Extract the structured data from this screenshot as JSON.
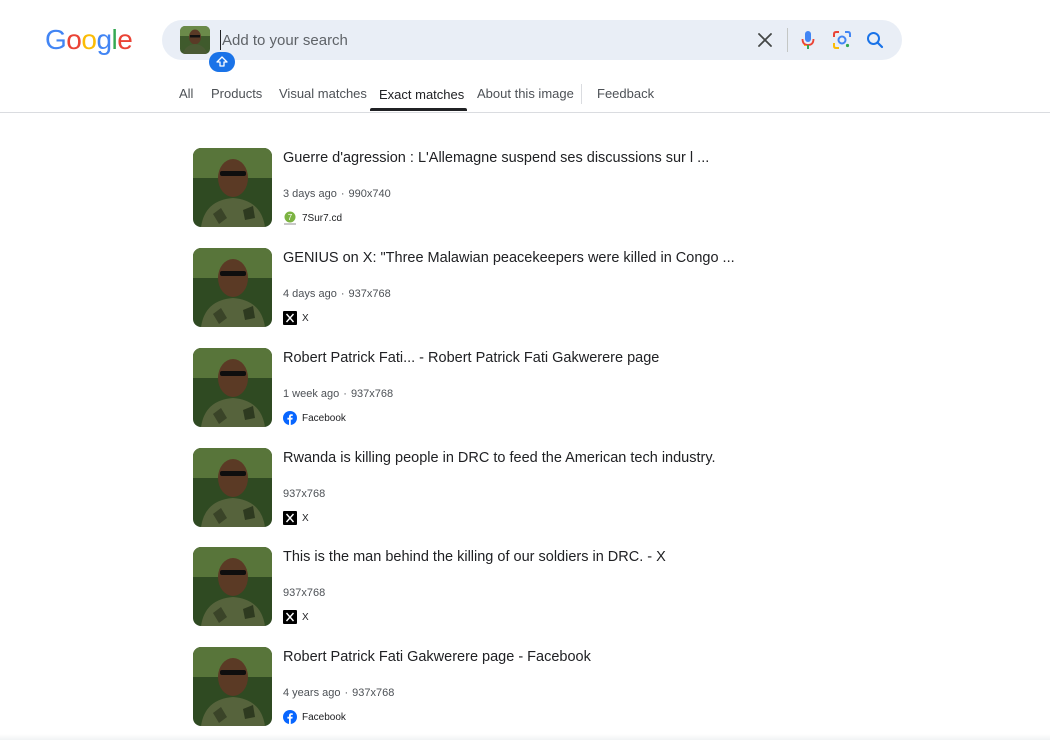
{
  "logo": {
    "text": "Google",
    "letters": [
      "G",
      "o",
      "o",
      "g",
      "l",
      "e"
    ],
    "colors": [
      "#4285F4",
      "#EA4335",
      "#FBBC05",
      "#4285F4",
      "#34A853",
      "#EA4335"
    ]
  },
  "search": {
    "placeholder": "Add to your search",
    "value": ""
  },
  "icons": {
    "clear": "close-icon",
    "voice": "microphone-icon",
    "lens": "lens-camera-icon",
    "search": "search-icon",
    "upload": "upload-arrow-icon"
  },
  "tabs": [
    {
      "label": "All",
      "active": false
    },
    {
      "label": "Products",
      "active": false
    },
    {
      "label": "Visual matches",
      "active": false
    },
    {
      "label": "Exact matches",
      "active": true
    },
    {
      "label": "About this image",
      "active": false
    },
    {
      "label": "Feedback",
      "active": false
    }
  ],
  "results": [
    {
      "title": "Guerre d'agression : L'Allemagne suspend ses discussions sur l ...",
      "age": "3 days ago",
      "dims": "990x740",
      "source": "7Sur7.cd",
      "source_icon": "7sur7-icon"
    },
    {
      "title": "GENIUS on X: \"Three Malawian peacekeepers were killed in Congo ...",
      "age": "4 days ago",
      "dims": "937x768",
      "source": "X",
      "source_icon": "x-logo-icon"
    },
    {
      "title": "Robert Patrick Fati... - Robert Patrick Fati Gakwerere page",
      "age": "1 week ago",
      "dims": "937x768",
      "source": "Facebook",
      "source_icon": "facebook-icon"
    },
    {
      "title": "Rwanda is killing people in DRC to feed the American tech industry.",
      "age": "",
      "dims": "937x768",
      "source": "X",
      "source_icon": "x-logo-icon"
    },
    {
      "title": "This is the man behind the killing of our soldiers in DRC. - X",
      "age": "",
      "dims": "937x768",
      "source": "X",
      "source_icon": "x-logo-icon"
    },
    {
      "title": "Robert Patrick Fati Gakwerere page - Facebook",
      "age": "4 years ago",
      "dims": "937x768",
      "source": "Facebook",
      "source_icon": "facebook-icon"
    }
  ],
  "colors": {
    "accent": "#1a73e8",
    "text": "#202124",
    "muted": "#4d5156",
    "searchbar_bg": "#e9eef6",
    "facebook": "#0866ff"
  }
}
